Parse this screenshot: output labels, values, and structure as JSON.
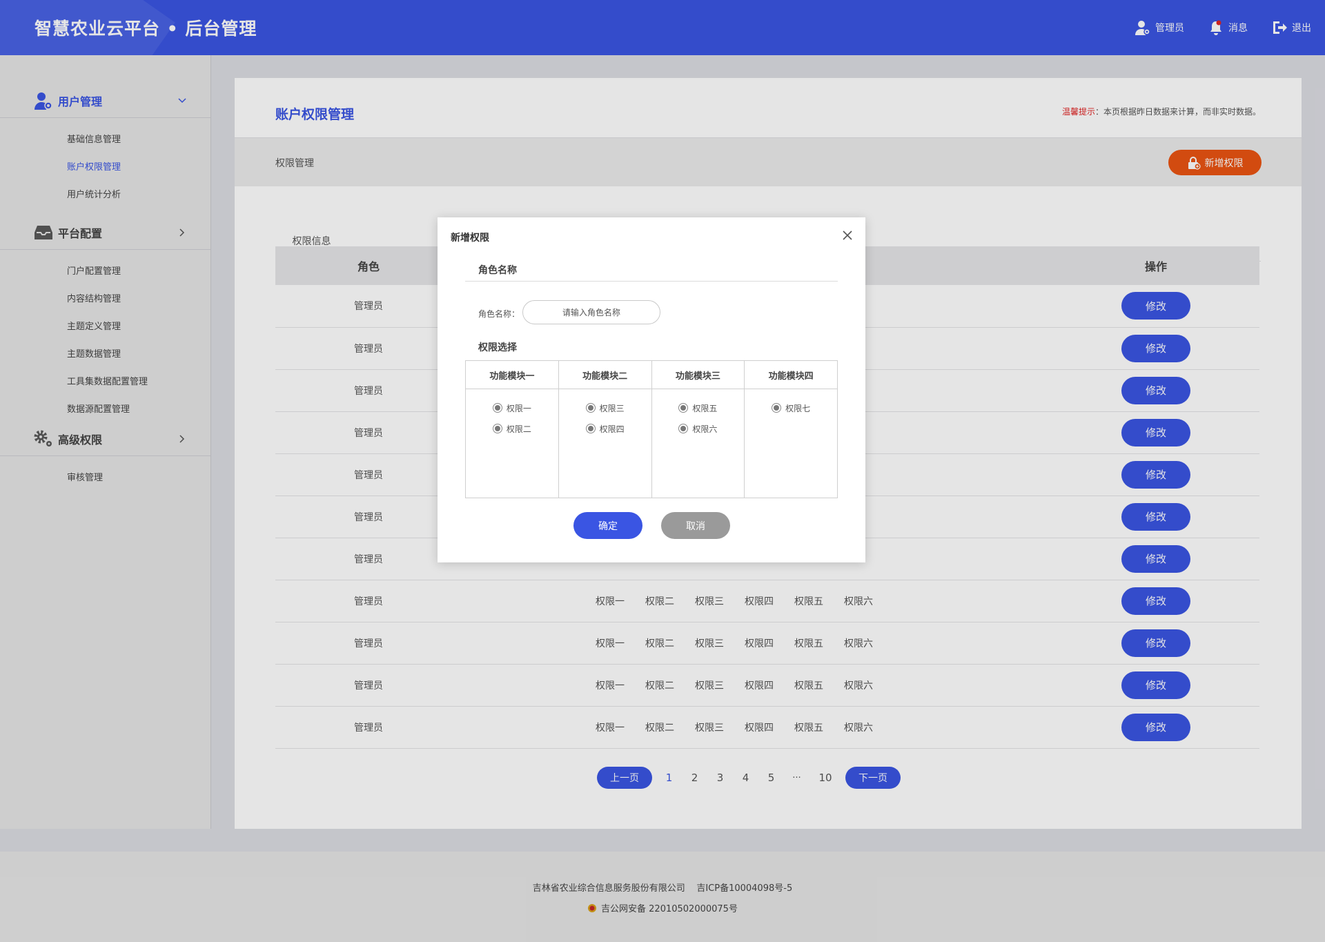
{
  "header": {
    "logo": "智慧农业云平台 • 后台管理",
    "admin_label": "管理员",
    "message_label": "消息",
    "logout_label": "退出"
  },
  "sidebar": {
    "groups": [
      {
        "label": "用户管理",
        "icon": "user-gear-icon",
        "expanded": true,
        "items": [
          {
            "label": "基础信息管理"
          },
          {
            "label": "账户权限管理",
            "active": true
          },
          {
            "label": "用户统计分析"
          }
        ]
      },
      {
        "label": "平台配置",
        "icon": "inbox-icon",
        "expanded": false,
        "items": [
          {
            "label": "门户配置管理"
          },
          {
            "label": "内容结构管理"
          },
          {
            "label": "主题定义管理"
          },
          {
            "label": "主题数据管理"
          },
          {
            "label": "工具集数据配置管理"
          },
          {
            "label": "数据源配置管理"
          }
        ]
      },
      {
        "label": "高级权限",
        "icon": "gears-icon",
        "expanded": false,
        "items": [
          {
            "label": "审核管理"
          }
        ]
      }
    ]
  },
  "main": {
    "title": "账户权限管理",
    "tip_label": "温馨提示",
    "tip_text": "：本页根据昨日数据来计算，而非实时数据。",
    "subbar_label": "权限管理",
    "add_button": "新增权限",
    "tab": "权限信息",
    "table": {
      "headers": {
        "role": "角色",
        "op": "操作"
      },
      "edit_label": "修改",
      "rows": [
        {
          "role": "管理员",
          "perms": []
        },
        {
          "role": "管理员",
          "perms": []
        },
        {
          "role": "管理员",
          "perms": []
        },
        {
          "role": "管理员",
          "perms": []
        },
        {
          "role": "管理员",
          "perms": []
        },
        {
          "role": "管理员",
          "perms": []
        },
        {
          "role": "管理员",
          "perms": []
        },
        {
          "role": "管理员",
          "perms": [
            "权限一",
            "权限二",
            "权限三",
            "权限四",
            "权限五",
            "权限六"
          ]
        },
        {
          "role": "管理员",
          "perms": [
            "权限一",
            "权限二",
            "权限三",
            "权限四",
            "权限五",
            "权限六"
          ]
        },
        {
          "role": "管理员",
          "perms": [
            "权限一",
            "权限二",
            "权限三",
            "权限四",
            "权限五",
            "权限六"
          ]
        },
        {
          "role": "管理员",
          "perms": [
            "权限一",
            "权限二",
            "权限三",
            "权限四",
            "权限五",
            "权限六"
          ]
        }
      ]
    },
    "pagination": {
      "prev": "上一页",
      "next": "下一页",
      "pages": [
        "1",
        "2",
        "3",
        "4",
        "5"
      ],
      "ellipsis": "···",
      "last": "10",
      "current": "1"
    }
  },
  "modal": {
    "title": "新增权限",
    "section_name": "角色名称",
    "field_label": "角色名称：",
    "input_placeholder": "请输入角色名称",
    "input_value": "",
    "section_perm": "权限选择",
    "modules": [
      {
        "name": "功能模块一",
        "perms": [
          "权限一",
          "权限二"
        ]
      },
      {
        "name": "功能模块二",
        "perms": [
          "权限三",
          "权限四"
        ]
      },
      {
        "name": "功能模块三",
        "perms": [
          "权限五",
          "权限六"
        ]
      },
      {
        "name": "功能模块四",
        "perms": [
          "权限七"
        ]
      }
    ],
    "ok": "确定",
    "cancel": "取消"
  },
  "footer": {
    "company": "吉林省农业综合信息服务股份有限公司",
    "icp": "吉ICP备10004098号-5",
    "police": "吉公网安备 22010502000075号"
  },
  "colors": {
    "primary": "#3a55e3",
    "accent": "#ea5412",
    "warning": "#e02424"
  }
}
